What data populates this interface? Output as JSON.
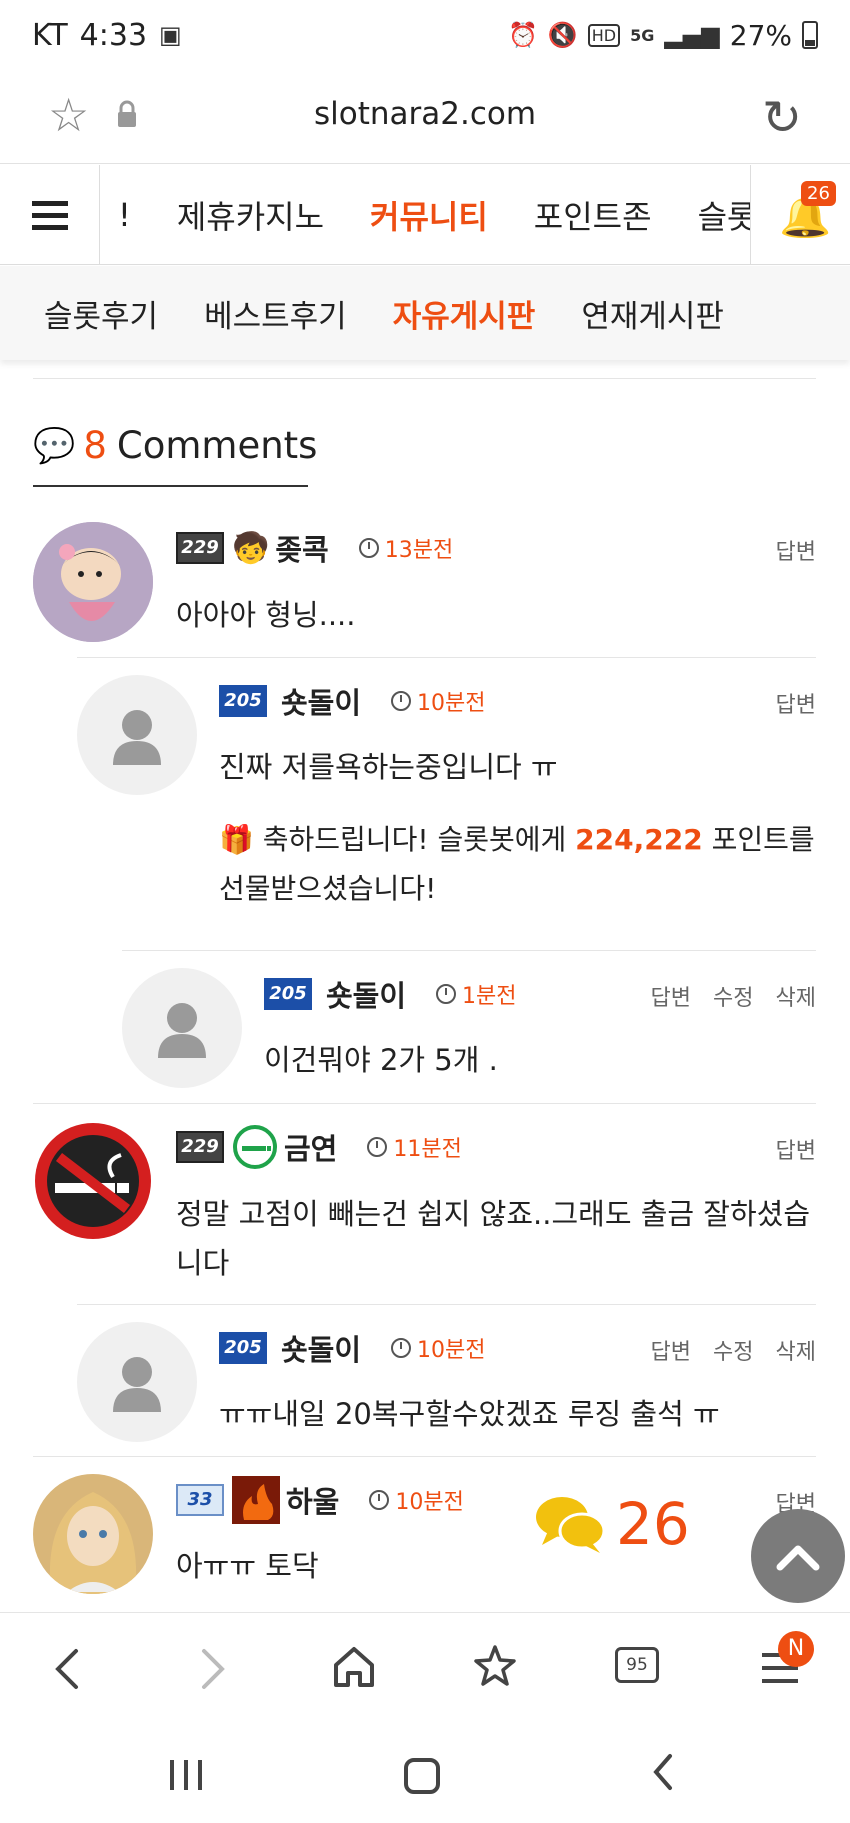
{
  "status": {
    "carrier": "KT",
    "time": "4:33",
    "battery": "27%",
    "network": "5G",
    "hd": "HD"
  },
  "browser": {
    "url": "slotnara2.com"
  },
  "main_nav": {
    "items": [
      "!",
      "제휴카지노",
      "커뮤니티",
      "포인트존",
      "슬롯"
    ],
    "active": "커뮤니티",
    "notification_count": "26"
  },
  "sub_nav": {
    "items": [
      "슬롯후기",
      "베스트후기",
      "자유게시판",
      "연재게시판"
    ],
    "active": "자유게시판"
  },
  "comments_header": {
    "count": "8",
    "label": "Comments"
  },
  "comments": [
    {
      "level": "229",
      "name": "좆콕",
      "time": "13분전",
      "actions": [
        "답변"
      ],
      "text": "아아아 형닝...."
    },
    {
      "level": "205",
      "name": "숏돌이",
      "time": "10분전",
      "actions": [
        "답변"
      ],
      "text": "진짜 저를욕하는중입니다 ㅠ",
      "gift": {
        "prefix": "축하드립니다! 슬롯봇에게 ",
        "points": "224,222",
        "suffix": " 포인트를",
        "line2": "선물받으셨습니다!"
      }
    },
    {
      "level": "205",
      "name": "숏돌이",
      "time": "1분전",
      "actions": [
        "답변",
        "수정",
        "삭제"
      ],
      "text": "이건뭐야 2가 5개 ."
    },
    {
      "level": "229",
      "name": "금연",
      "time": "11분전",
      "actions": [
        "답변"
      ],
      "text": "정말 고점이 빼는건 쉽지 않죠..그래도 출금 잘하셨습",
      "text2": "니다"
    },
    {
      "level": "205",
      "name": "숏돌이",
      "time": "10분전",
      "actions": [
        "답변",
        "수정",
        "삭제"
      ],
      "text": "ㅠㅠ내일 20복구할수았겠죠 루징 출석 ㅠ"
    },
    {
      "level": "33",
      "name": "하울",
      "time": "10분전",
      "actions": [
        "답변"
      ],
      "text": "아ㅠㅠ 토닥"
    }
  ],
  "floating": {
    "chat_count": "26"
  },
  "bottom_bar": {
    "tabs_count": "95",
    "badge": "N"
  },
  "colors": {
    "accent": "#ee4e12",
    "level_blue": "#1c4fa8"
  }
}
